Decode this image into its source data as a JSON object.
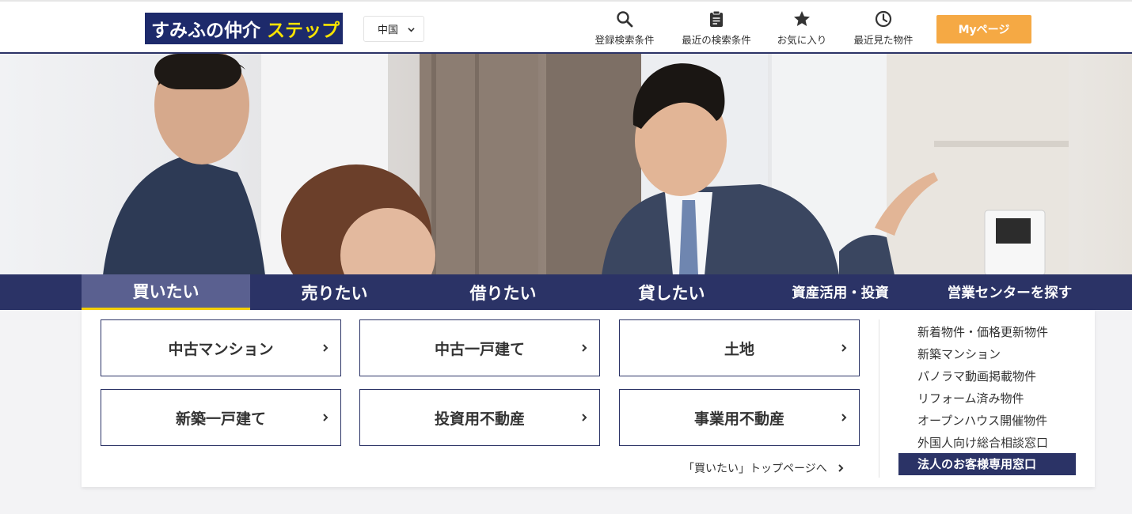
{
  "header": {
    "logo_main": "すみふの仲介",
    "logo_accent": "ステップ",
    "region_selected": "中国",
    "nav": [
      {
        "label": "登録検索条件",
        "icon": "search-icon"
      },
      {
        "label": "最近の検索条件",
        "icon": "clipboard-icon"
      },
      {
        "label": "お気に入り",
        "icon": "star-icon"
      },
      {
        "label": "最近見た物件",
        "icon": "clock-icon"
      }
    ],
    "mypage_label": "Myページ"
  },
  "tabs": [
    {
      "label": "買いたい",
      "active": true
    },
    {
      "label": "売りたい",
      "active": false
    },
    {
      "label": "借りたい",
      "active": false
    },
    {
      "label": "貸したい",
      "active": false
    },
    {
      "label": "資産活用・投資",
      "active": false
    },
    {
      "label": "営業センターを探す",
      "active": false
    }
  ],
  "categories": [
    {
      "label": "中古マンション"
    },
    {
      "label": "中古一戸建て"
    },
    {
      "label": "土地"
    },
    {
      "label": "新築一戸建て"
    },
    {
      "label": "投資用不動産"
    },
    {
      "label": "事業用不動産"
    }
  ],
  "buy_top_link": "「買いたい」トップページへ",
  "side_links": [
    "新着物件・価格更新物件",
    "新築マンション",
    "パノラマ動画掲載物件",
    "リフォーム済み物件",
    "オープンハウス開催物件",
    "外国人向け総合相談窓口"
  ],
  "side_highlight": "法人のお客様専用窓口",
  "colors": {
    "navy": "#2b3366",
    "logo_bg": "#1d2a6b",
    "logo_accent": "#f7e300",
    "mypage_bg": "#f5a944",
    "active_underline": "#f5d000"
  }
}
